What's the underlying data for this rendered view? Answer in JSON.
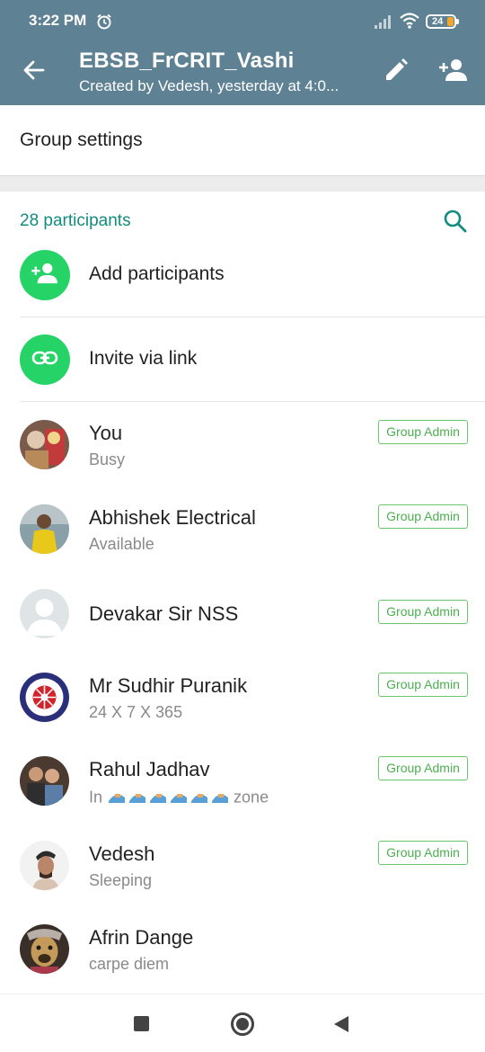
{
  "status_bar": {
    "time": "3:22 PM",
    "battery": "24",
    "icons": [
      "alarm-icon",
      "signal-icon",
      "wifi-icon",
      "battery-icon"
    ]
  },
  "app_bar": {
    "title": "EBSB_FrCRIT_Vashi",
    "subtitle": "Created by Vedesh, yesterday at 4:0...",
    "icons": [
      "back-arrow-icon",
      "edit-pencil-icon",
      "add-person-icon"
    ]
  },
  "group_settings": {
    "label": "Group settings"
  },
  "participants": {
    "count_label": "28 participants",
    "actions": [
      {
        "label": "Add participants",
        "icon": "add-person-icon"
      },
      {
        "label": "Invite via link",
        "icon": "link-icon"
      }
    ],
    "members": [
      {
        "name": "You",
        "status": "Busy",
        "badge": "Group Admin"
      },
      {
        "name": "Abhishek Electrical",
        "status": "Available",
        "badge": "Group Admin"
      },
      {
        "name": "Devakar Sir NSS",
        "status": "",
        "badge": "Group Admin"
      },
      {
        "name": "Mr Sudhir Puranik",
        "status": "24 X 7 X 365",
        "badge": "Group Admin"
      },
      {
        "name": "Rahul Jadhav",
        "status_prefix": "In",
        "status_suffix": "zone",
        "badge": "Group Admin"
      },
      {
        "name": "Vedesh",
        "status": "Sleeping",
        "badge": "Group Admin"
      },
      {
        "name": "Afrin Dange",
        "status": "carpe diem",
        "badge": ""
      }
    ]
  },
  "colors": {
    "app_bar": "#5e8193",
    "accent_green": "#25d366",
    "teal": "#128c7e",
    "badge_green": "#4caf50"
  }
}
